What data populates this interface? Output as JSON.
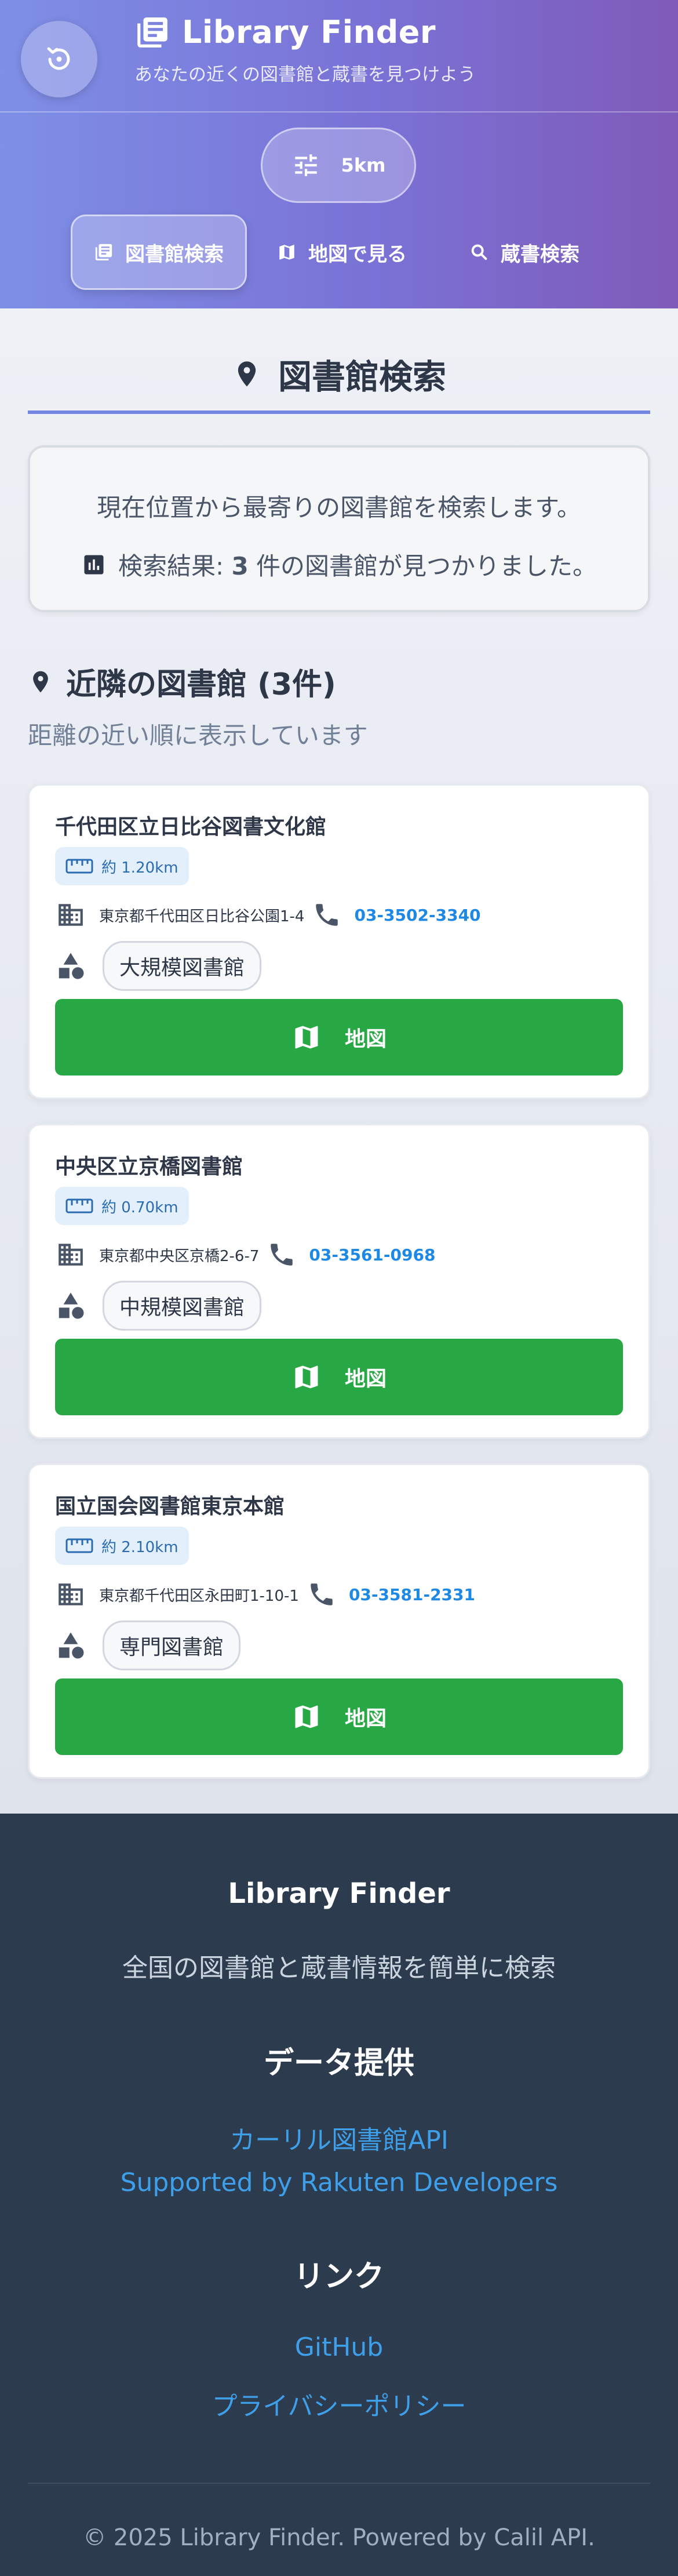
{
  "header": {
    "app_title": "Library Finder",
    "subtitle": "あなたの近くの図書館と蔵書を見つけよう",
    "range_label": "5km"
  },
  "nav": {
    "items": [
      {
        "label": "図書館検索",
        "icon": "library-books-icon",
        "active": true
      },
      {
        "label": "地図で見る",
        "icon": "map-icon",
        "active": false
      },
      {
        "label": "蔵書検索",
        "icon": "search-icon",
        "active": false
      }
    ]
  },
  "main": {
    "page_title": "図書館検索",
    "info_text": "現在位置から最寄りの図書館を検索します。",
    "result_prefix": "検索結果: ",
    "result_count": "3",
    "result_suffix": " 件の図書館が見つかりました。",
    "section_title": "近隣の図書館 (3件)",
    "section_subtitle": "距離の近い順に表示しています"
  },
  "libraries": [
    {
      "name": "千代田区立日比谷図書文化館",
      "distance": "約 1.20km",
      "address": "東京都千代田区日比谷公園1-4",
      "phone": "03-3502-3340",
      "type": "大規模図書館",
      "map_label": "地図"
    },
    {
      "name": "中央区立京橋図書館",
      "distance": "約 0.70km",
      "address": "東京都中央区京橋2-6-7",
      "phone": "03-3561-0968",
      "type": "中規模図書館",
      "map_label": "地図"
    },
    {
      "name": "国立国会図書館東京本館",
      "distance": "約 2.10km",
      "address": "東京都千代田区永田町1-10-1",
      "phone": "03-3581-2331",
      "type": "専門図書館",
      "map_label": "地図"
    }
  ],
  "footer": {
    "title": "Library Finder",
    "description": "全国の図書館と蔵書情報を簡単に検索",
    "data_heading": "データ提供",
    "data_links": [
      "カーリル図書館API",
      "Supported by Rakuten Developers"
    ],
    "links_heading": "リンク",
    "links": [
      "GitHub",
      "プライバシーポリシー"
    ],
    "copyright": "© 2025 Library Finder. Powered by Calil API."
  },
  "colors": {
    "accent": "#7286e2",
    "map_button": "#28a745",
    "phone_link": "#1e88e5",
    "footer_bg": "#2d3b4e",
    "footer_link": "#3ea0ea"
  }
}
